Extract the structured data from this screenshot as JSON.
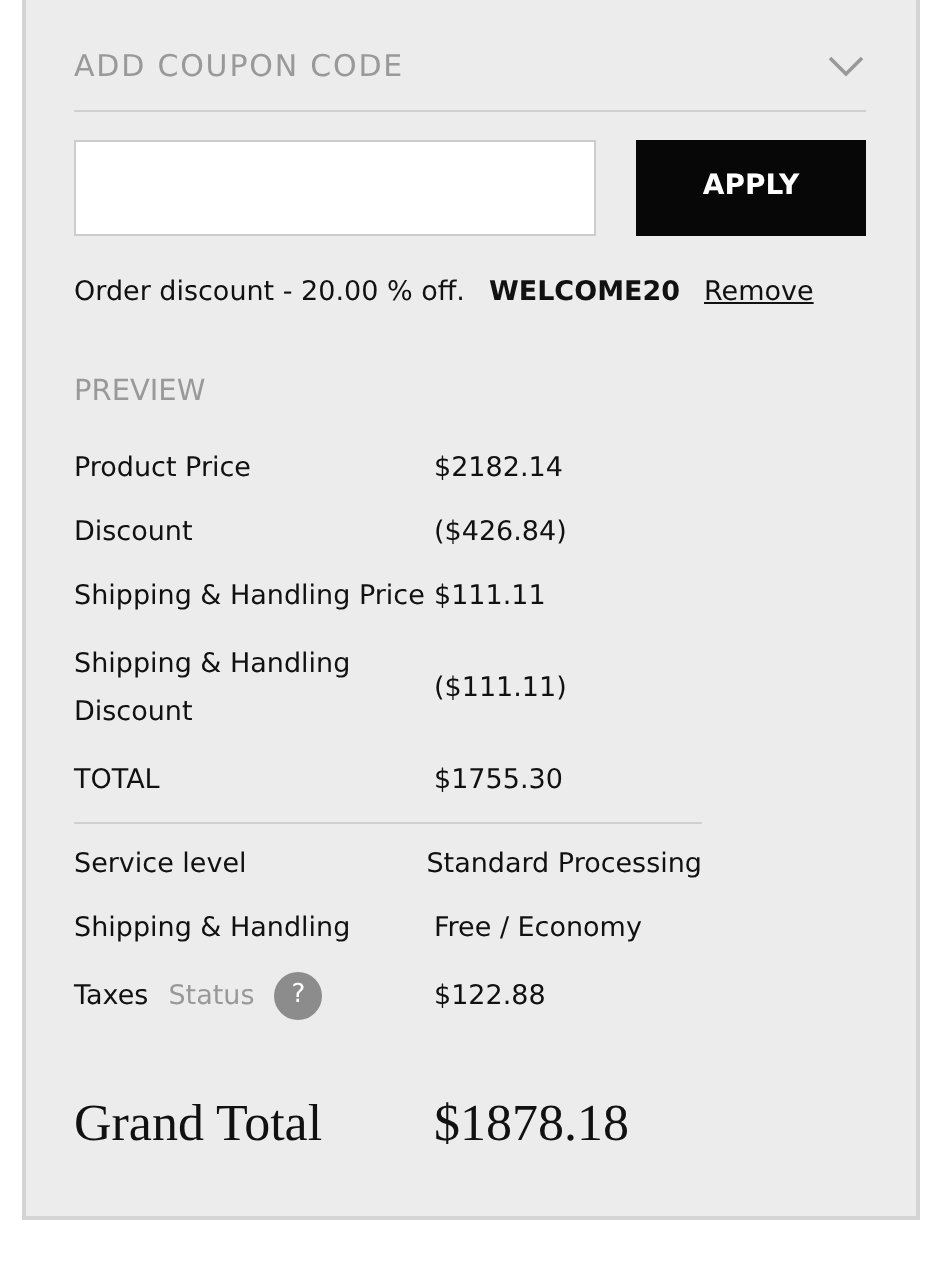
{
  "coupon": {
    "title": "ADD COUPON CODE",
    "expanded": true,
    "button": "APPLY"
  },
  "discount": {
    "text": "Order discount - 20.00 % off.",
    "code": "WELCOME20",
    "remove": "Remove"
  },
  "preview": {
    "title": "PREVIEW",
    "rows": [
      {
        "label": "Product Price",
        "value": "$2182.14"
      },
      {
        "label": "Discount",
        "value": "($426.84)"
      },
      {
        "label": "Shipping & Handling Price",
        "value": "$111.11"
      },
      {
        "label": "Shipping & Handling Discount",
        "value": "($111.11)"
      },
      {
        "label": "TOTAL",
        "value": "$1755.30"
      }
    ]
  },
  "details": [
    {
      "label": "Service level",
      "value": "Standard Processing"
    },
    {
      "label": "Shipping & Handling",
      "value": "Free / Economy"
    },
    {
      "label": "Taxes",
      "status": "Status",
      "help": "?",
      "value": "$122.88"
    }
  ],
  "grand_total": {
    "label": "Grand Total",
    "value": "$1878.18"
  }
}
